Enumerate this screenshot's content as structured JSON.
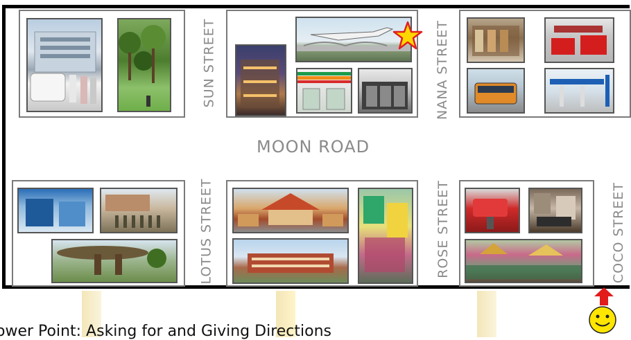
{
  "map": {
    "road_label": "MOON ROAD",
    "streets": {
      "sun": "SUN STREET",
      "nana": "NANA STREET",
      "lotus": "LOTUS STREET",
      "rose": "ROSE STREET",
      "coco": "COCO STREET"
    }
  },
  "markers": {
    "destination": "star-icon",
    "start": "smiley-face-icon",
    "direction": "up-arrow-icon"
  },
  "caption": "ower Point: Asking for and Giving Directions",
  "colors": {
    "label_gray": "#8a8a8a",
    "star_fill": "#ffd700",
    "star_stroke": "#e02020",
    "arrow_red": "#e21b1b",
    "smiley_yellow": "#ffe600"
  }
}
